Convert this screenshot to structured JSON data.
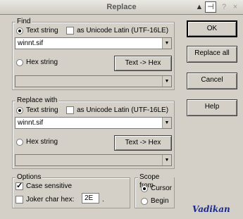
{
  "window": {
    "title": "Replace",
    "controls": [
      "▲",
      "⊣",
      "?",
      "×"
    ]
  },
  "find": {
    "group_label": "Find",
    "text_radio_label": "Text string",
    "unicode_label": "as Unicode Latin (UTF-16LE)",
    "text_value": "winnt.sif",
    "hex_radio_label": "Hex string",
    "text_to_hex_label": "Text -> Hex",
    "hex_value": ""
  },
  "replace": {
    "group_label": "Replace with",
    "text_radio_label": "Text string",
    "unicode_label": "as Unicode Latin (UTF-16LE)",
    "text_value": "winnt.sif",
    "hex_radio_label": "Hex string",
    "text_to_hex_label": "Text -> Hex",
    "hex_value": ""
  },
  "options": {
    "group_label": "Options",
    "case_sensitive_label": "Case sensitive",
    "case_sensitive_checked": true,
    "joker_label": "Joker char hex:",
    "joker_checked": false,
    "joker_value": "2E",
    "joker_suffix": "."
  },
  "scope": {
    "group_label": "Scope from",
    "cursor_label": "Cursor",
    "begin_label": "Begin",
    "selected": "Cursor"
  },
  "buttons": {
    "ok": "OK",
    "replace_all": "Replace all",
    "cancel": "Cancel",
    "help": "Help"
  },
  "watermark": "Vadikan"
}
